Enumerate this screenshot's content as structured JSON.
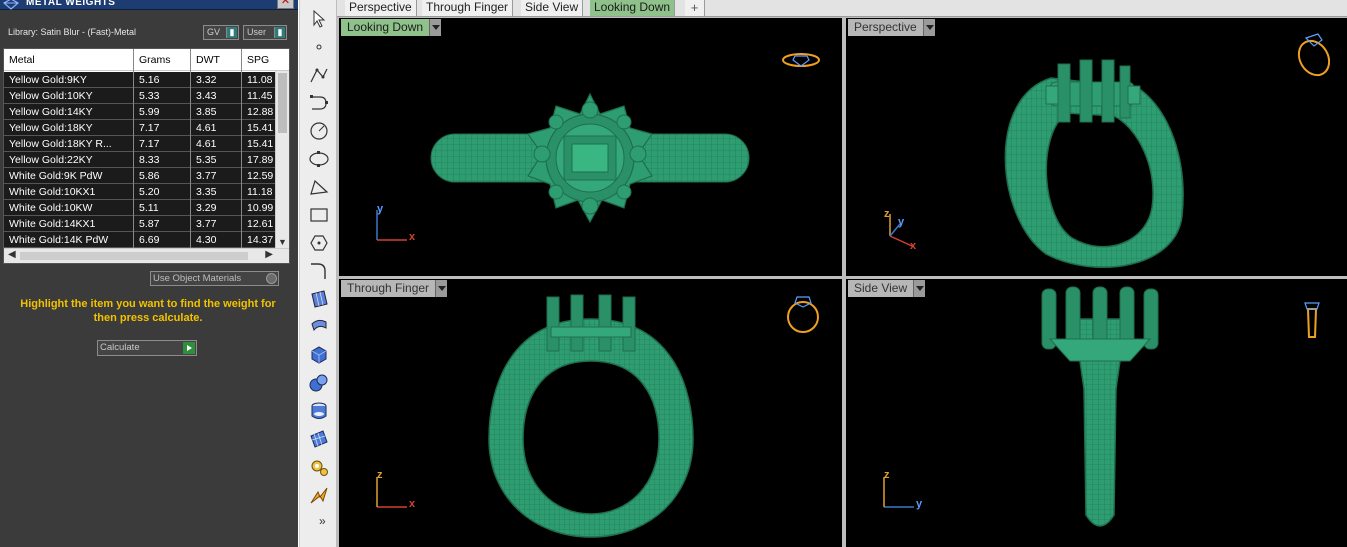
{
  "panel": {
    "title": "METAL WEIGHTS",
    "library_label": "Library: Satin Blur - (Fast)-Metal",
    "gv_label": "GV",
    "user_label": "User",
    "use_object_materials": "Use Object Materials",
    "hint": "Highlight the item you want to find the weight for then press calculate.",
    "calculate_label": "Calculate"
  },
  "table": {
    "headers": [
      "Metal",
      "Grams",
      "DWT",
      "SPG"
    ],
    "rows": [
      [
        "Yellow Gold:9KY",
        "5.16",
        "3.32",
        "11.08"
      ],
      [
        "Yellow Gold:10KY",
        "5.33",
        "3.43",
        "11.45"
      ],
      [
        "Yellow Gold:14KY",
        "5.99",
        "3.85",
        "12.88"
      ],
      [
        "Yellow Gold:18KY",
        "7.17",
        "4.61",
        "15.41"
      ],
      [
        "Yellow Gold:18KY R...",
        "7.17",
        "4.61",
        "15.41"
      ],
      [
        "Yellow Gold:22KY",
        "8.33",
        "5.35",
        "17.89"
      ],
      [
        "White Gold:9K PdW",
        "5.86",
        "3.77",
        "12.59"
      ],
      [
        "White Gold:10KX1",
        "5.20",
        "3.35",
        "11.18"
      ],
      [
        "White Gold:10KW",
        "5.11",
        "3.29",
        "10.99"
      ],
      [
        "White Gold:14KX1",
        "5.87",
        "3.77",
        "12.61"
      ],
      [
        "White Gold:14K PdW",
        "6.69",
        "4.30",
        "14.37"
      ]
    ]
  },
  "tabs": [
    "Perspective",
    "Through Finger",
    "Side View",
    "Looking Down"
  ],
  "active_tab": "Looking Down",
  "add_tab": "+",
  "viewports": [
    {
      "title": "Looking Down",
      "axis_v": "y",
      "axis_h": "x"
    },
    {
      "title": "Perspective",
      "axis_v": "z",
      "axis_h": "x",
      "axis_d": "y"
    },
    {
      "title": "Through Finger",
      "axis_v": "z",
      "axis_h": "x"
    },
    {
      "title": "Side View",
      "axis_v": "z",
      "axis_h": "y"
    }
  ],
  "toolbar_more": "»",
  "colors": {
    "wireframe": "#2e9e72",
    "wire_lines": "#1f6e4d",
    "viewport_bg": "#000000",
    "highlight_text": "#f2c200",
    "active_tab": "#8fc18a",
    "axis_x": "#d2412e",
    "axis_y": "#3a78c9",
    "axis_z": "#e0a030",
    "gizmo": "#f0a020"
  },
  "tool_icons": [
    "select-arrow-icon",
    "point-icon",
    "polyline-icon",
    "curve-icon",
    "circle-icon",
    "ellipse-icon",
    "arc-icon",
    "rectangle-icon",
    "polygon-icon",
    "fillet-icon",
    "surface-icon",
    "extrude-surface-icon",
    "box-icon",
    "sphere-icon",
    "cylinder-icon",
    "mesh-icon",
    "gear-icon",
    "lightning-icon"
  ]
}
